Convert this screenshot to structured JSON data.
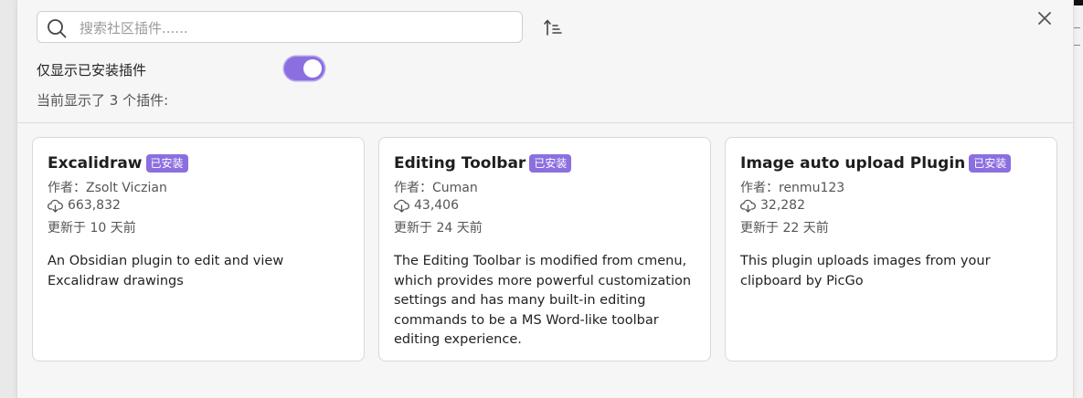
{
  "search": {
    "placeholder": "搜索社区插件......",
    "value": ""
  },
  "filter": {
    "label": "仅显示已安装插件",
    "enabled": true
  },
  "count": {
    "prefix": "当前显示了",
    "number": "3",
    "suffix": "个插件:"
  },
  "colors": {
    "accent": "#8b6fe0"
  },
  "icons": {
    "search": "search-icon",
    "sort": "sort-icon",
    "close": "close-icon",
    "download": "download-icon"
  },
  "plugins": [
    {
      "name": "Excalidraw",
      "badge": "已安装",
      "author": "作者：Zsolt Viczian",
      "downloads": "663,832",
      "updated": "更新于 10 天前",
      "description": "An Obsidian plugin to edit and view Excalidraw drawings"
    },
    {
      "name": "Editing Toolbar",
      "badge": "已安装",
      "author": "作者：Cuman",
      "downloads": "43,406",
      "updated": "更新于 24 天前",
      "description": "The Editing Toolbar is modified from cmenu, which provides more powerful customization settings and has many built-in editing commands to be a MS Word-like toolbar editing experience."
    },
    {
      "name": "Image auto upload Plugin",
      "badge": "已安装",
      "author": "作者：renmu123",
      "downloads": "32,282",
      "updated": "更新于 22 天前",
      "description": "This plugin uploads images from your clipboard by PicGo"
    }
  ]
}
